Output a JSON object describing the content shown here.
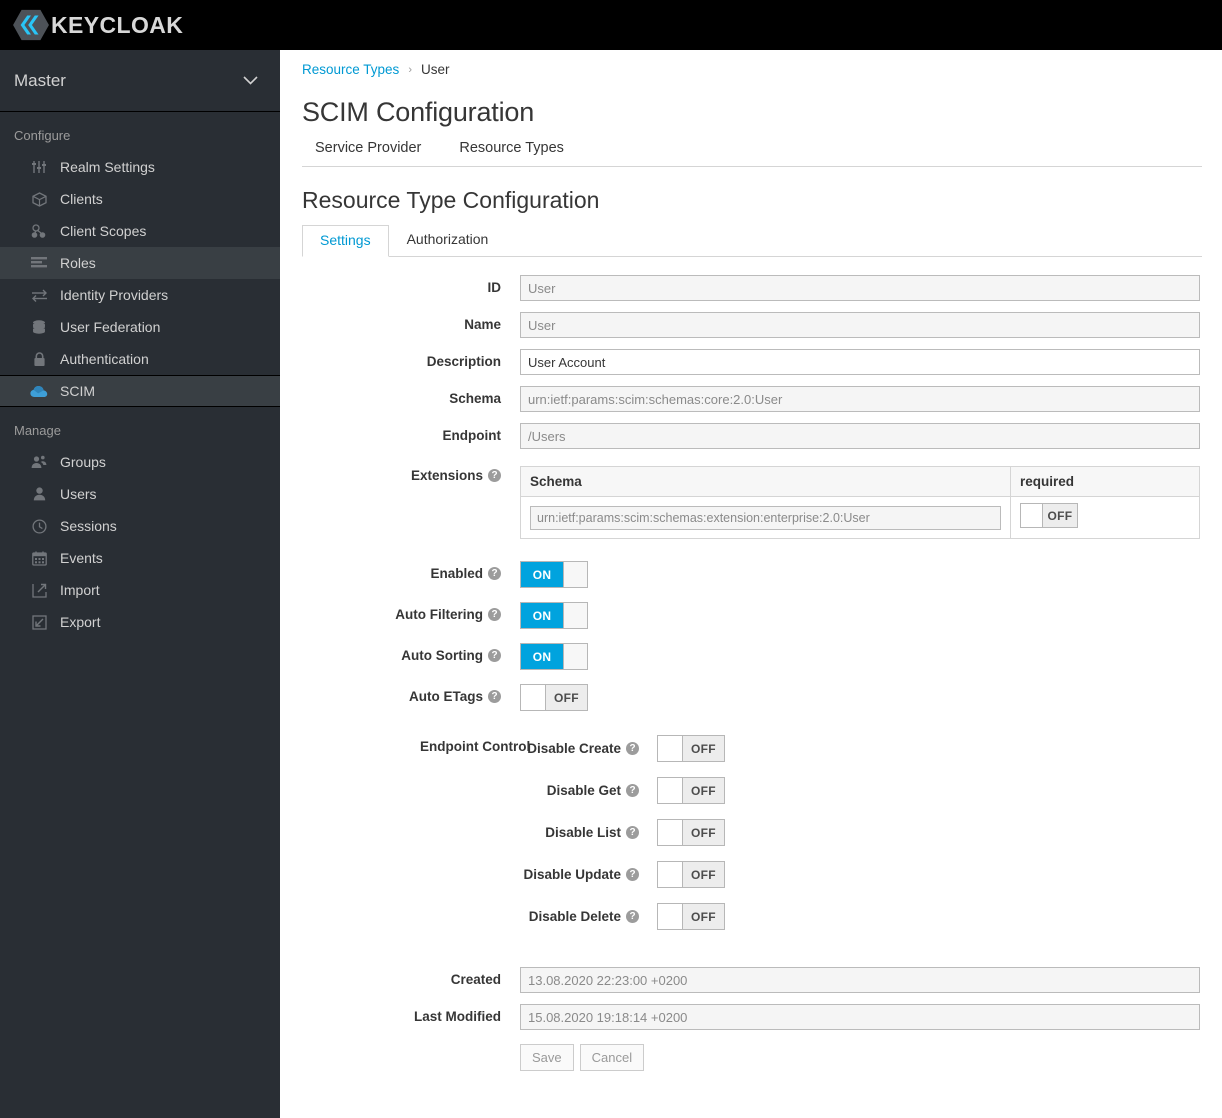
{
  "masthead": {
    "brand": "KEYCLOAK",
    "logo_icon": "keycloak-hexagon-icon"
  },
  "sidebar": {
    "realm": {
      "name": "Master",
      "chevron_icon": "chevron-down-icon"
    },
    "sections": [
      {
        "title": "Configure",
        "items": [
          {
            "label": "Realm Settings",
            "icon": "sliders-icon",
            "state": "normal"
          },
          {
            "label": "Clients",
            "icon": "cube-icon",
            "state": "normal"
          },
          {
            "label": "Client Scopes",
            "icon": "cubes-icon",
            "state": "normal"
          },
          {
            "label": "Roles",
            "icon": "list-bars-icon",
            "state": "hover"
          },
          {
            "label": "Identity Providers",
            "icon": "exchange-arrows-icon",
            "state": "normal"
          },
          {
            "label": "User Federation",
            "icon": "database-icon",
            "state": "normal"
          },
          {
            "label": "Authentication",
            "icon": "lock-icon",
            "state": "normal"
          },
          {
            "label": "SCIM",
            "icon": "cloud-icon",
            "state": "active"
          }
        ]
      },
      {
        "title": "Manage",
        "items": [
          {
            "label": "Groups",
            "icon": "users-group-icon",
            "state": "normal"
          },
          {
            "label": "Users",
            "icon": "user-icon",
            "state": "normal"
          },
          {
            "label": "Sessions",
            "icon": "clock-icon",
            "state": "normal"
          },
          {
            "label": "Events",
            "icon": "calendar-icon",
            "state": "normal"
          },
          {
            "label": "Import",
            "icon": "import-arrow-icon",
            "state": "normal"
          },
          {
            "label": "Export",
            "icon": "export-arrow-icon",
            "state": "normal"
          }
        ]
      }
    ]
  },
  "breadcrumb": {
    "parent": "Resource Types",
    "separator": "›",
    "current": "User"
  },
  "page": {
    "title": "SCIM Configuration",
    "toplinks": [
      {
        "label": "Service Provider"
      },
      {
        "label": "Resource Types"
      }
    ],
    "section_title": "Resource Type Configuration",
    "tabs": [
      {
        "label": "Settings",
        "active": true
      },
      {
        "label": "Authorization",
        "active": false
      }
    ]
  },
  "form": {
    "id": {
      "label": "ID",
      "value": "User",
      "disabled": true
    },
    "name": {
      "label": "Name",
      "value": "User",
      "disabled": true
    },
    "description": {
      "label": "Description",
      "value": "User Account",
      "disabled": false
    },
    "schema": {
      "label": "Schema",
      "value": "urn:ietf:params:scim:schemas:core:2.0:User",
      "disabled": true
    },
    "endpoint": {
      "label": "Endpoint",
      "value": "/Users",
      "disabled": true
    },
    "extensions": {
      "label": "Extensions",
      "help_icon": "help-circle-icon",
      "columns": [
        "Schema",
        "required"
      ],
      "rows": [
        {
          "schema": "urn:ietf:params:scim:schemas:extension:enterprise:2.0:User",
          "required": "OFF",
          "required_on": false
        }
      ]
    },
    "toggles": [
      {
        "label": "Enabled",
        "state": "ON",
        "on": true,
        "help_icon": "help-circle-icon"
      },
      {
        "label": "Auto Filtering",
        "state": "ON",
        "on": true,
        "help_icon": "help-circle-icon"
      },
      {
        "label": "Auto Sorting",
        "state": "ON",
        "on": true,
        "help_icon": "help-circle-icon"
      },
      {
        "label": "Auto ETags",
        "state": "OFF",
        "on": false,
        "help_icon": "help-circle-icon"
      }
    ],
    "endpoint_control": {
      "label": "Endpoint Control",
      "rows": [
        {
          "label": "Disable Create",
          "state": "OFF",
          "on": false,
          "help_icon": "help-circle-icon"
        },
        {
          "label": "Disable Get",
          "state": "OFF",
          "on": false,
          "help_icon": "help-circle-icon"
        },
        {
          "label": "Disable List",
          "state": "OFF",
          "on": false,
          "help_icon": "help-circle-icon"
        },
        {
          "label": "Disable Update",
          "state": "OFF",
          "on": false,
          "help_icon": "help-circle-icon"
        },
        {
          "label": "Disable Delete",
          "state": "OFF",
          "on": false,
          "help_icon": "help-circle-icon"
        }
      ]
    },
    "created": {
      "label": "Created",
      "value": "13.08.2020 22:23:00 +0200",
      "disabled": true
    },
    "last_modified": {
      "label": "Last Modified",
      "value": "15.08.2020 19:18:14 +0200",
      "disabled": true
    },
    "buttons": {
      "save": "Save",
      "cancel": "Cancel"
    }
  },
  "colors": {
    "accent_blue": "#0099d3",
    "toggle_on": "#00a3de",
    "sidebar_bg": "#292e34",
    "sidebar_active": "#393f44",
    "masthead_bg": "#000000",
    "scim_icon_blue": "#3e9fd8"
  }
}
